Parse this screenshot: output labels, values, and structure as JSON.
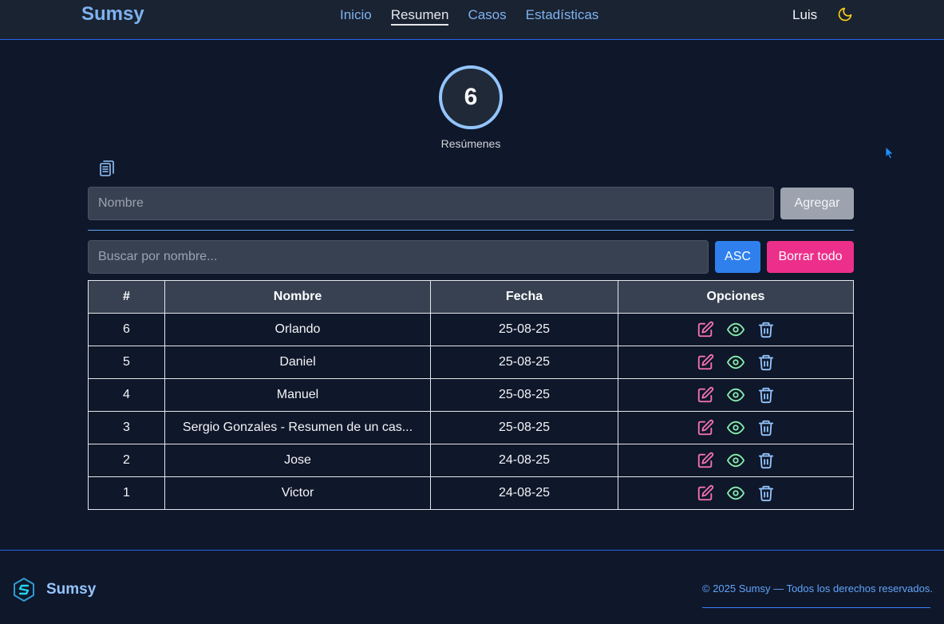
{
  "header": {
    "brand": "Sumsy",
    "nav": [
      "Inicio",
      "Resumen",
      "Casos",
      "Estadísticas"
    ],
    "active_nav": "Resumen",
    "user": "Luis",
    "theme_icon": "moon-icon",
    "colors": {
      "brand": "#7fb2f0",
      "moon": "#facc15"
    }
  },
  "summary": {
    "count": "6",
    "label": "Resúmenes",
    "copy_icon": "clipboard-icon"
  },
  "form": {
    "name_placeholder": "Nombre",
    "add_label": "Agregar"
  },
  "toolbar": {
    "search_placeholder": "Buscar por nombre...",
    "sort_label": "ASC",
    "clear_label": "Borrar todo",
    "colors": {
      "sort": "#2f80ed",
      "clear": "#ec2f8a"
    }
  },
  "table": {
    "headers": [
      "#",
      "Nombre",
      "Fecha",
      "Opciones"
    ],
    "rows": [
      {
        "num": "6",
        "name": "Orlando",
        "date": "25-08-25"
      },
      {
        "num": "5",
        "name": "Daniel",
        "date": "25-08-25"
      },
      {
        "num": "4",
        "name": "Manuel",
        "date": "25-08-25"
      },
      {
        "num": "3",
        "name": "Sergio Gonzales - Resumen de un cas...",
        "date": "25-08-25"
      },
      {
        "num": "2",
        "name": "Jose",
        "date": "24-08-25"
      },
      {
        "num": "1",
        "name": "Victor",
        "date": "24-08-25"
      }
    ],
    "option_icons": [
      "edit-icon",
      "eye-icon",
      "trash-icon"
    ],
    "colors": {
      "edit": "#f472b6",
      "view": "#86efac",
      "delete": "#93c5fd"
    }
  },
  "footer": {
    "brand": "Sumsy",
    "copyright": "© 2025 Sumsy — Todos los derechos reservados."
  }
}
